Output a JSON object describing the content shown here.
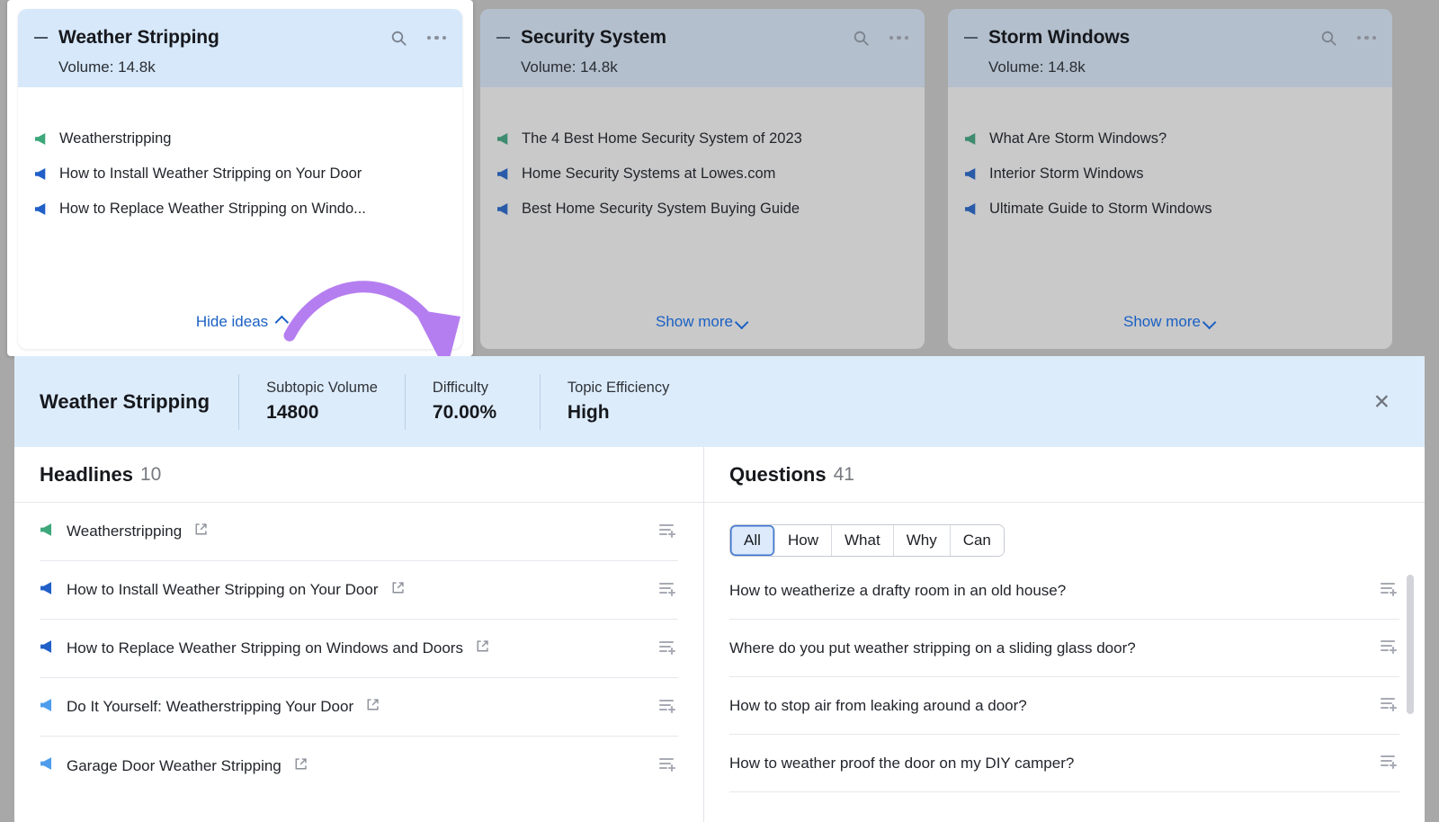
{
  "cards": [
    {
      "title": "Weather Stripping",
      "volume_label": "Volume: 14.8k",
      "ideas": [
        {
          "text": "Weatherstripping",
          "color": "green"
        },
        {
          "text": "How to Install Weather Stripping on Your Door",
          "color": "blue"
        },
        {
          "text": "How to Replace Weather Stripping on Windo...",
          "color": "blue"
        }
      ],
      "footer_label": "Hide ideas",
      "footer_state": "expanded",
      "active": true
    },
    {
      "title": "Security System",
      "volume_label": "Volume: 14.8k",
      "ideas": [
        {
          "text": "The 4 Best Home Security System of 2023",
          "color": "green"
        },
        {
          "text": "Home Security Systems at Lowes.com",
          "color": "blue"
        },
        {
          "text": "Best Home Security System Buying Guide",
          "color": "blue"
        }
      ],
      "footer_label": "Show more",
      "footer_state": "collapsed",
      "active": false
    },
    {
      "title": "Storm Windows",
      "volume_label": "Volume: 14.8k",
      "ideas": [
        {
          "text": "What Are Storm Windows?",
          "color": "green"
        },
        {
          "text": "Interior Storm Windows",
          "color": "blue"
        },
        {
          "text": "Ultimate Guide to Storm Windows",
          "color": "blue"
        }
      ],
      "footer_label": "Show more",
      "footer_state": "collapsed",
      "active": false
    }
  ],
  "metric_bar": {
    "topic": "Weather Stripping",
    "metrics": [
      {
        "label": "Subtopic Volume",
        "value": "14800"
      },
      {
        "label": "Difficulty",
        "value": "70.00%"
      },
      {
        "label": "Topic Efficiency",
        "value": "High"
      }
    ],
    "close_label": "✕"
  },
  "headlines_panel": {
    "title": "Headlines",
    "count": "10",
    "rows": [
      {
        "text": "Weatherstripping",
        "color": "green"
      },
      {
        "text": "How to Install Weather Stripping on Your Door",
        "color": "blue"
      },
      {
        "text": "How to Replace Weather Stripping on Windows and Doors",
        "color": "blue"
      },
      {
        "text": "Do It Yourself: Weatherstripping Your Door",
        "color": "lightblue"
      },
      {
        "text": "Garage Door Weather Stripping",
        "color": "lightblue"
      }
    ]
  },
  "questions_panel": {
    "title": "Questions",
    "count": "41",
    "filters": [
      {
        "label": "All",
        "active": true
      },
      {
        "label": "How",
        "active": false
      },
      {
        "label": "What",
        "active": false
      },
      {
        "label": "Why",
        "active": false
      },
      {
        "label": "Can",
        "active": false
      }
    ],
    "rows": [
      {
        "text": "How to weatherize a drafty room in an old house?"
      },
      {
        "text": "Where do you put weather stripping on a sliding glass door?"
      },
      {
        "text": "How to stop air from leaking around a door?"
      },
      {
        "text": "How to weather proof the door on my DIY camper?"
      }
    ]
  },
  "colors": {
    "page_bg": "#a8a8a8",
    "active_header": "#d6e8fa",
    "dim_header": "#b3bfcc",
    "dim_body": "#c9c9c9",
    "metric_bar": "#ddecfb",
    "link_blue": "#1a60c4",
    "megaphone_green": "#3ea87a",
    "megaphone_blue": "#2060c8",
    "megaphone_lightblue": "#4e9ded",
    "annotation_purple": "#b57ef0"
  }
}
